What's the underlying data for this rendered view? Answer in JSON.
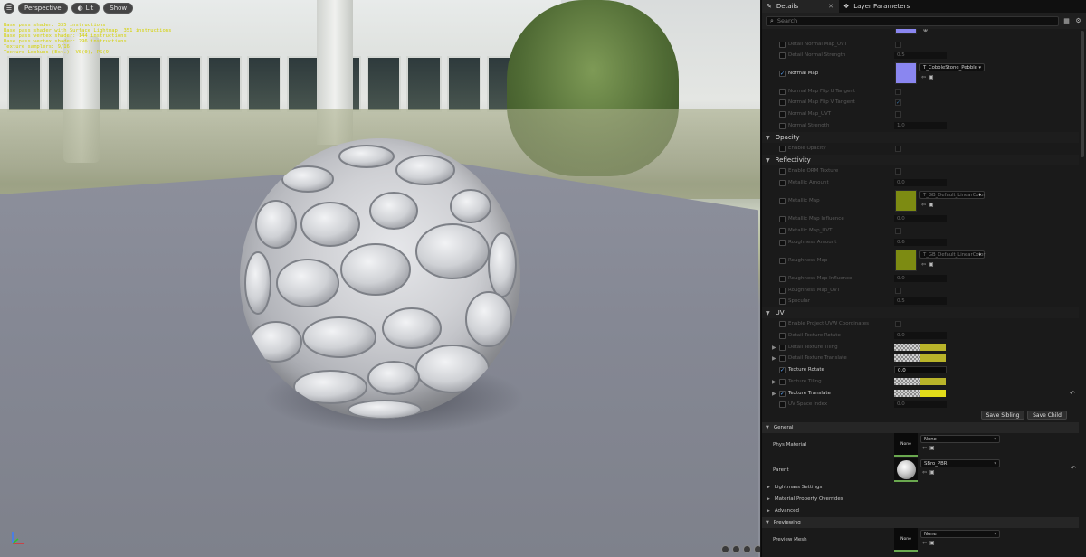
{
  "viewport": {
    "toolbar": {
      "menu_icon": "hamburger-icon",
      "perspective": "Perspective",
      "lit": "Lit",
      "show": "Show"
    },
    "stats": [
      "Base pass shader: 335 instructions",
      "Base pass shader with Surface Lightmap: 351 instructions",
      "Base pass vertex shader: 144 instructions",
      "Base pass vertex shader: 296 instructions",
      "Texture samplers: 9/16",
      "Texture Lookups (Est.): VS(0), PS(9)"
    ]
  },
  "panel": {
    "tabs": [
      {
        "label": "Details",
        "icon": "pencil-icon"
      },
      {
        "label": "Layer Parameters",
        "icon": "layers-icon"
      }
    ],
    "search": {
      "placeholder": "Search"
    },
    "rows": {
      "detail_normal_uvt": "Detail Normal Map_UVT",
      "detail_normal_strength": {
        "label": "Detail Normal Strength",
        "value": "0.5"
      },
      "normal_map": {
        "label": "Normal Map",
        "texture": "T_CobbleStone_Pebble_N"
      },
      "nm_flip_u": "Normal Map Flip U Tangent",
      "nm_flip_v": "Normal Map Flip V Tangent",
      "nm_uvt": "Normal Map_UVT",
      "normal_strength": {
        "label": "Normal Strength",
        "value": "1.0"
      },
      "opacity": "Opacity",
      "enable_opacity": "Enable Opacity",
      "reflectivity": "Reflectivity",
      "enable_orm": "Enable ORM Texture",
      "metallic_amount": {
        "label": "Metallic Amount",
        "value": "0.0"
      },
      "metallic_map": {
        "label": "Metallic Map",
        "texture": "T_GB_Default_LinearColor"
      },
      "metallic_influence": {
        "label": "Metallic Map Influence",
        "value": "0.0"
      },
      "metallic_uvt": "Metallic Map_UVT",
      "roughness_amount": {
        "label": "Roughness Amount",
        "value": "0.6"
      },
      "roughness_map": {
        "label": "Roughness Map",
        "texture": "T_GB_Default_LinearColor"
      },
      "roughness_influence": {
        "label": "Roughness Map Influence",
        "value": "0.0"
      },
      "roughness_uvt": "Roughness Map_UVT",
      "specular": {
        "label": "Specular",
        "value": "0.5"
      },
      "uv": "UV",
      "enable_projector": "Enable Project UVW Coordinates",
      "detail_tex_rotate": {
        "label": "Detail Texture Rotate",
        "value": "0.0"
      },
      "detail_tex_tiling": "Detail Texture Tiling",
      "detail_tex_translate": "Detail Texture Translate",
      "texture_rotate": {
        "label": "Texture Rotate",
        "value": "0.0"
      },
      "texture_tiling": "Texture Tiling",
      "texture_translate": "Texture Translate",
      "uv_space_index": {
        "label": "UV Space Index",
        "value": "0.0"
      }
    },
    "buttons": {
      "save_sibling": "Save Sibling",
      "save_child": "Save Child"
    },
    "general": {
      "title": "General",
      "phys_material": {
        "label": "Phys Material",
        "thumb": "None",
        "value": "None"
      },
      "parent": {
        "label": "Parent",
        "value": "SBro_PBR"
      }
    },
    "collapsed": [
      "Lightmass Settings",
      "Material Property Overrides",
      "Advanced"
    ],
    "previewing": {
      "title": "Previewing",
      "preview_mesh": {
        "label": "Preview Mesh",
        "thumb": "None",
        "value": "None"
      }
    },
    "colors": {
      "normal_swatch": "#8a86f0",
      "metallic_swatch": "#7d8b12",
      "accent_check": "#5fa9ff"
    }
  }
}
